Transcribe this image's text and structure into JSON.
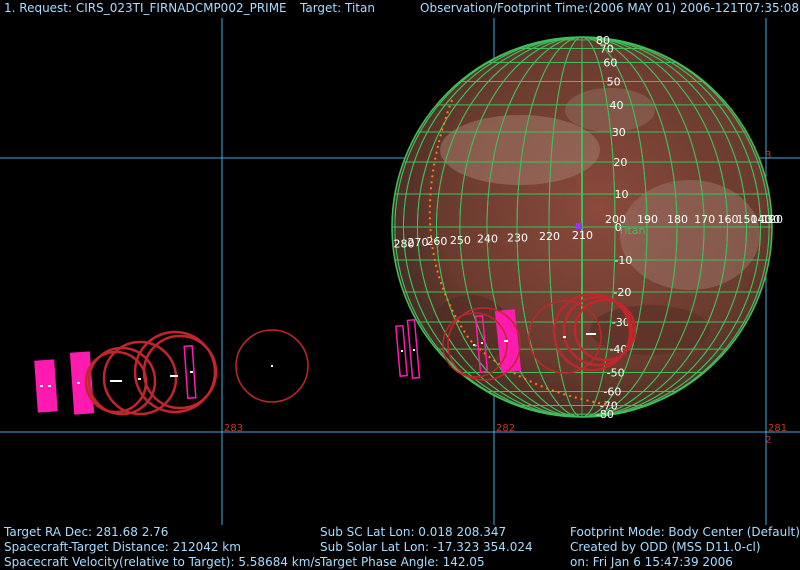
{
  "header": {
    "request": "1. Request:  CIRS_023TI_FIRNADCMP002_PRIME",
    "target": "Target: Titan",
    "time": "Observation/Footprint Time:(2006 MAY 01) 2006-121T07:35:08.50"
  },
  "grid": {
    "ra_labels": [
      "283",
      "282",
      "281"
    ],
    "dec_labels": [
      "3",
      "2"
    ],
    "colors": {
      "grid": "#4aa8e0",
      "ra_label": "#c0392b"
    }
  },
  "globe": {
    "name": "Titan",
    "lat_labels": [
      "80",
      "70",
      "60",
      "50",
      "40",
      "30",
      "20",
      "10",
      "0",
      "-10",
      "-20",
      "-30",
      "-40",
      "-50",
      "-60",
      "-70",
      "-80"
    ],
    "lon_labels": [
      "280",
      "270",
      "260",
      "250",
      "240",
      "230",
      "220",
      "210",
      "200",
      "190",
      "180",
      "170",
      "160",
      "150",
      "140",
      "130",
      "120"
    ],
    "colors": {
      "grid": "#3fbf5a",
      "surface": "#6e3a30"
    }
  },
  "info": {
    "left": [
      "Target RA  Dec: 281.68    2.76",
      "Spacecraft-Target Distance:  212042 km",
      "Spacecraft Velocity(relative to Target): 5.58684 km/s"
    ],
    "middle": [
      "Sub SC Lat Lon:  0.018  208.347",
      "Sub Solar Lat Lon: -17.323  354.024",
      "Target Phase Angle: 142.05"
    ],
    "right": [
      "Footprint Mode: Body Center (Default)",
      "Created by ODD (MSS D11.0-cl)",
      "on: Fri Jan  6 15:47:39 2006"
    ]
  }
}
